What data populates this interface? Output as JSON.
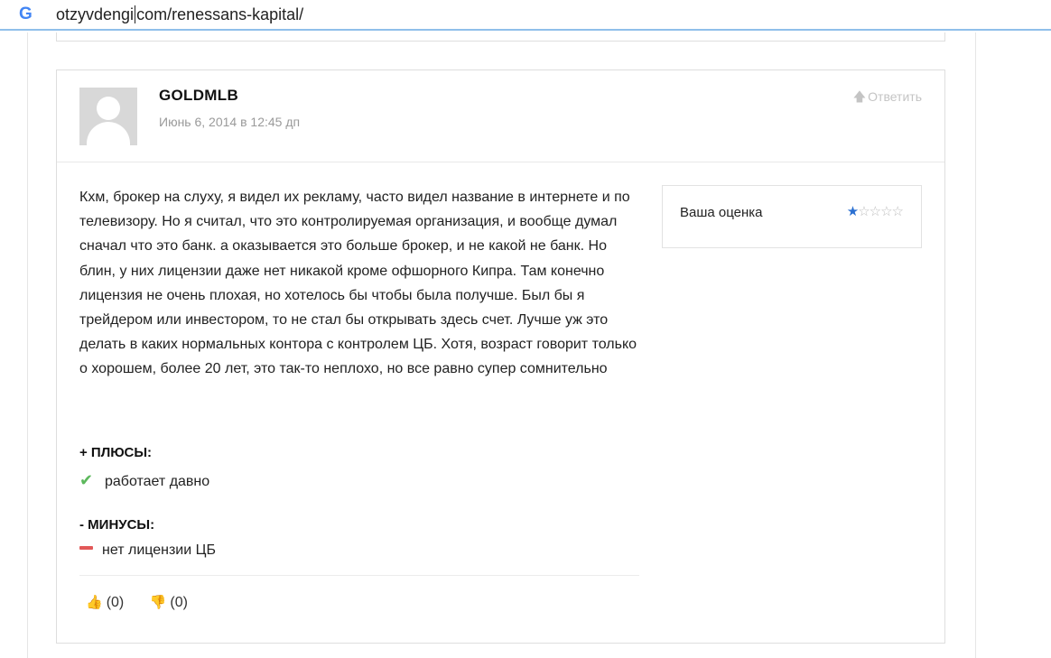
{
  "browser": {
    "logo_letter": "G",
    "url_before_caret": "otzyvdengi",
    "url_after_caret": "com/renessans-kapital/"
  },
  "review": {
    "author": "GOLDMLB",
    "date": "Июнь 6, 2014 в 12:45 дп",
    "reply_label": "Ответить",
    "text": "Кхм, брокер на слуху, я видел их рекламу, часто видел название в интернете и по телевизору. Но я считал, что это контролируемая организация, и вообще думал сначал что это банк. а оказывается это больше брокер, и не какой не банк. Но блин, у них лицензии даже нет никакой кроме офшорного Кипра. Там конечно лицензия не очень плохая, но хотелось бы чтобы была получше. Был бы я трейдером или инвестором, то не стал бы открывать здесь счет. Лучше уж это делать в каких нормальных контора с контролем ЦБ. Хотя, возраст говорит только о хорошем, более 20 лет, это так-то неплохо, но все равно супер сомнительно",
    "rating_label": "Ваша оценка",
    "rating_value": 1,
    "rating_max": 5,
    "pros_title": "+ ПЛЮСЫ:",
    "pros_item": "работает давно",
    "cons_title": "- МИНУСЫ:",
    "cons_item": "нет лицензии ЦБ",
    "likes": "(0)",
    "dislikes": "(0)"
  },
  "colors": {
    "accent_blue": "#2a6fd1",
    "pros_green": "#5cb85c",
    "cons_red": "#e25858",
    "dislike_red": "#d9342b"
  }
}
